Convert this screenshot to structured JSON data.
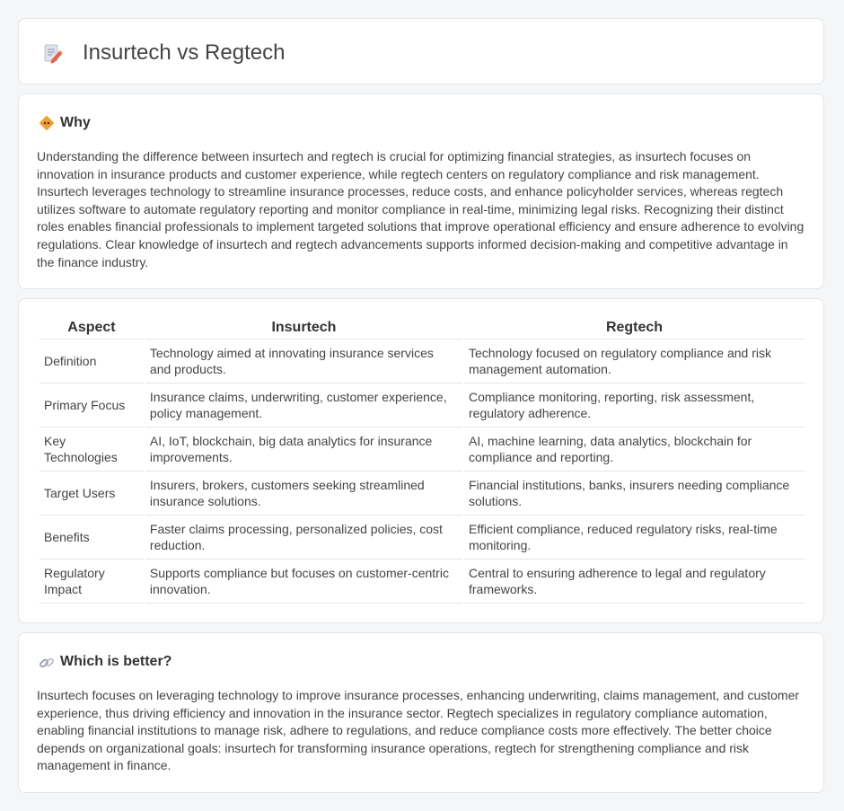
{
  "page": {
    "title": "Insurtech vs Regtech"
  },
  "why": {
    "heading": "Why",
    "text": "Understanding the difference between insurtech and regtech is crucial for optimizing financial strategies, as insurtech focuses on innovation in insurance products and customer experience, while regtech centers on regulatory compliance and risk management. Insurtech leverages technology to streamline insurance processes, reduce costs, and enhance policyholder services, whereas regtech utilizes software to automate regulatory reporting and monitor compliance in real-time, minimizing legal risks. Recognizing their distinct roles enables financial professionals to implement targeted solutions that improve operational efficiency and ensure adherence to evolving regulations. Clear knowledge of insurtech and regtech advancements supports informed decision-making and competitive advantage in the finance industry."
  },
  "comparison": {
    "headers": [
      "Aspect",
      "Insurtech",
      "Regtech"
    ],
    "rows": [
      [
        "Definition",
        "Technology aimed at innovating insurance services and products.",
        "Technology focused on regulatory compliance and risk management automation."
      ],
      [
        "Primary Focus",
        "Insurance claims, underwriting, customer experience, policy management.",
        "Compliance monitoring, reporting, risk assessment, regulatory adherence."
      ],
      [
        "Key Technologies",
        "AI, IoT, blockchain, big data analytics for insurance improvements.",
        "AI, machine learning, data analytics, blockchain for compliance and reporting."
      ],
      [
        "Target Users",
        "Insurers, brokers, customers seeking streamlined insurance solutions.",
        "Financial institutions, banks, insurers needing compliance solutions."
      ],
      [
        "Benefits",
        "Faster claims processing, personalized policies, cost reduction.",
        "Efficient compliance, reduced regulatory risks, real-time monitoring."
      ],
      [
        "Regulatory Impact",
        "Supports compliance but focuses on customer-centric innovation.",
        "Central to ensuring adherence to legal and regulatory frameworks."
      ]
    ]
  },
  "better": {
    "heading": "Which is better?",
    "text": "Insurtech focuses on leveraging technology to improve insurance processes, enhancing underwriting, claims management, and customer experience, thus driving efficiency and innovation in the insurance sector. Regtech specializes in regulatory compliance automation, enabling financial institutions to manage risk, adhere to regulations, and reduce compliance costs more effectively. The better choice depends on organizational goals: insurtech for transforming insurance operations, regtech for strengthening compliance and risk management in finance."
  },
  "icons": {
    "title": "document-pencil-icon",
    "why": "diamond-sign-icon",
    "better": "link-icon"
  },
  "colors": {
    "accent_orange": "#f0a030",
    "pencil_red": "#e8604c"
  }
}
